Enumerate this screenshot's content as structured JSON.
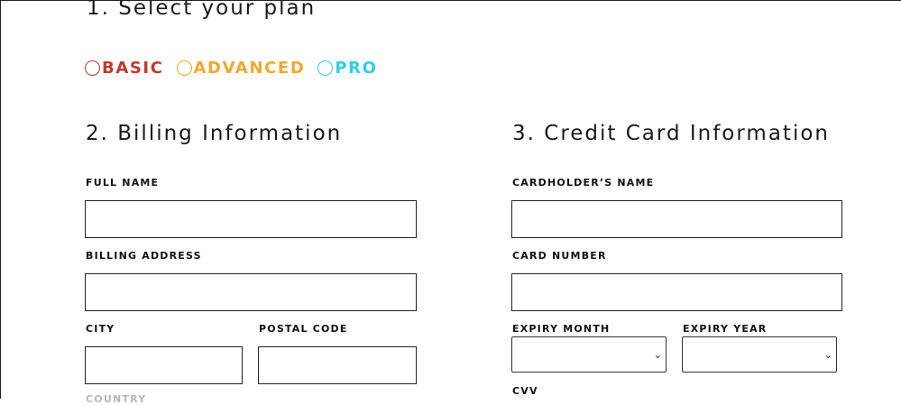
{
  "sections": {
    "plan_title": "1. Select your plan",
    "billing_title": "2. Billing Information",
    "card_title": "3. Credit Card Information"
  },
  "plans": [
    {
      "label": "BASIC",
      "color": "#c0392b"
    },
    {
      "label": "ADVANCED",
      "color": "#f0a830"
    },
    {
      "label": "PRO",
      "color": "#2ed0e0"
    }
  ],
  "billing": {
    "full_name_label": "FULL NAME",
    "full_name_value": "",
    "address_label": "BILLING ADDRESS",
    "address_value": "",
    "city_label": "CITY",
    "city_value": "",
    "postal_label": "POSTAL CODE",
    "postal_value": "",
    "country_label": "COUNTRY"
  },
  "card": {
    "holder_label": "CARDHOLDER’S NAME",
    "holder_value": "",
    "number_label": "CARD NUMBER",
    "number_value": "",
    "expiry_month_label": "EXPIRY MONTH",
    "expiry_year_label": "EXPIRY YEAR",
    "cvv_label": "CVV"
  },
  "icons": {
    "select_chevron": "chevron-down-icon"
  }
}
